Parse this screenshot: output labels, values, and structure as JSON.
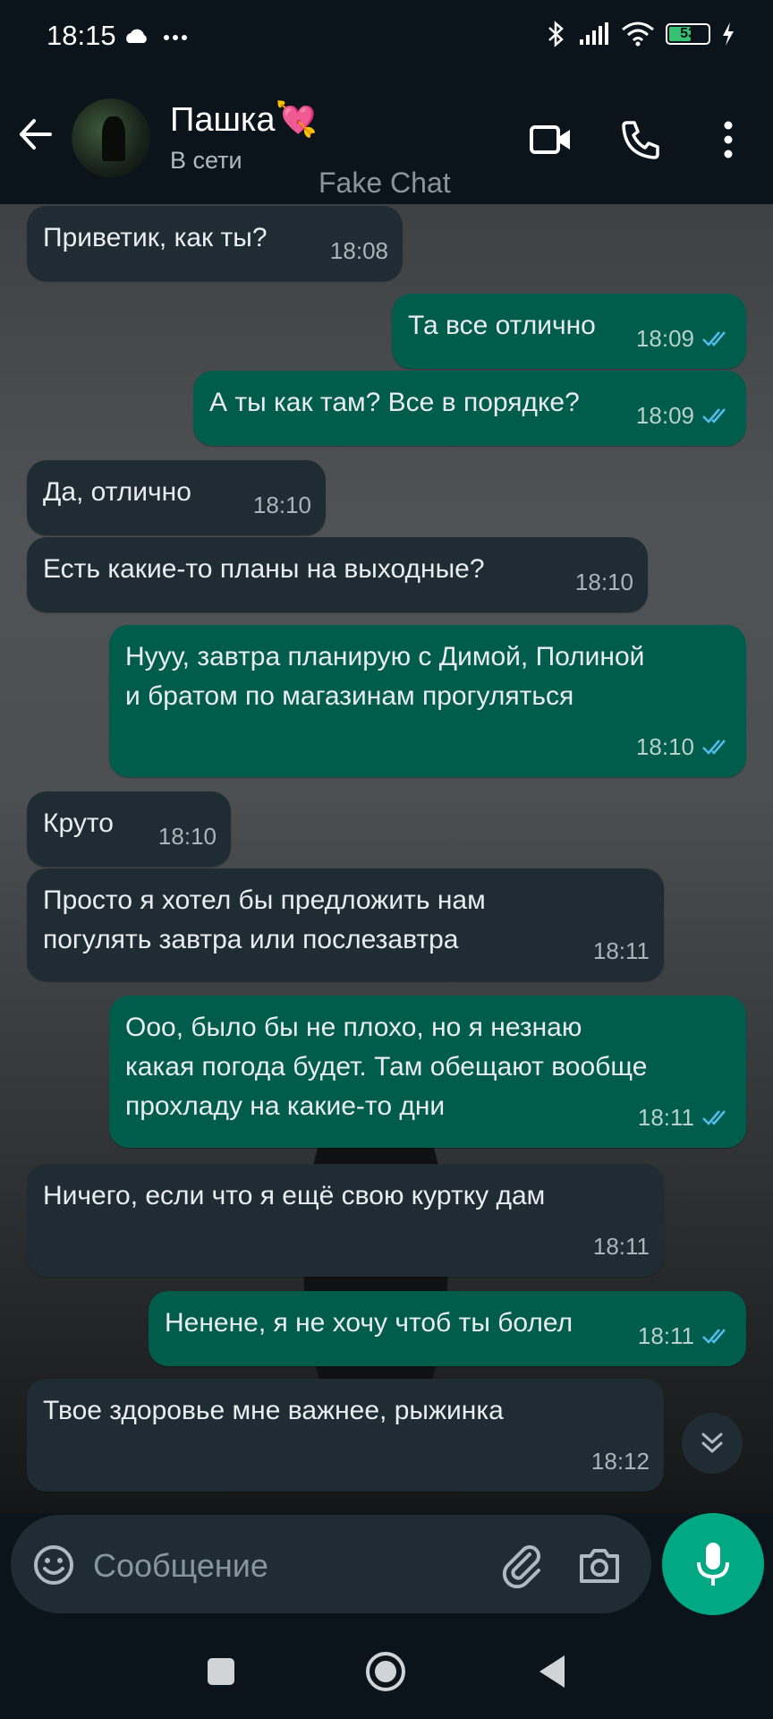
{
  "status_bar": {
    "time": "18:15",
    "battery": "53"
  },
  "header": {
    "contact_name": "Пашка💘",
    "contact_status": "В сети",
    "watermark": "Fake Chat"
  },
  "messages": [
    {
      "dir": "in",
      "text": "Приветик, как ты?",
      "time": "18:08"
    },
    {
      "dir": "out",
      "text": "Та все отлично",
      "time": "18:09",
      "read": true
    },
    {
      "dir": "out",
      "text": "А ты как там? Все в порядке?",
      "time": "18:09",
      "read": true
    },
    {
      "dir": "in",
      "text": "Да, отлично",
      "time": "18:10"
    },
    {
      "dir": "in",
      "text": "Есть какие-то планы на выходные?",
      "time": "18:10"
    },
    {
      "dir": "out",
      "text": "Нууу, завтра планирую с Димой, Полиной\nи братом по магазинам прогуляться",
      "time": "18:10",
      "read": true
    },
    {
      "dir": "in",
      "text": "Круто",
      "time": "18:10"
    },
    {
      "dir": "in",
      "text": "Просто я хотел бы предложить нам\nпогулять завтра или послезавтра",
      "time": "18:11"
    },
    {
      "dir": "out",
      "text": "Ооо, было бы не плохо, но я незнаю\nкакая погода будет. Там обещают вообще\nпрохладу на какие-то дни",
      "time": "18:11",
      "read": true
    },
    {
      "dir": "in",
      "text": "Ничего, если что я ещё свою куртку дам",
      "time": "18:11"
    },
    {
      "dir": "out",
      "text": "Ненене, я не хочу чтоб ты болел",
      "time": "18:11",
      "read": true
    },
    {
      "dir": "in",
      "text": "Твое здоровье мне важнее, рыжинка",
      "time": "18:12"
    }
  ],
  "composer": {
    "placeholder": "Сообщение"
  },
  "colors": {
    "incoming_bubble": "#202c33",
    "outgoing_bubble": "#005c4b",
    "accent": "#00a884",
    "read_ticks": "#53bdeb"
  }
}
